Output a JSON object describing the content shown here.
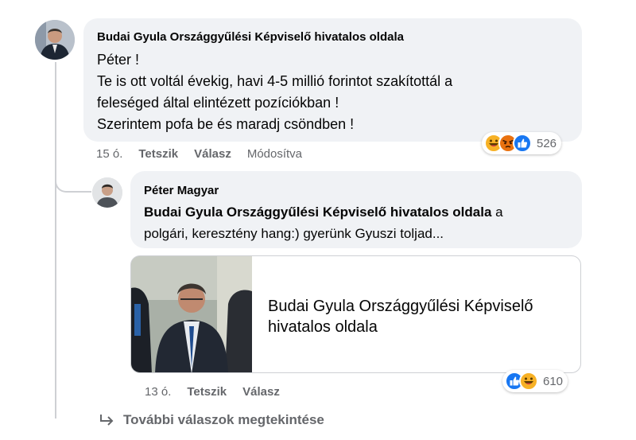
{
  "comment1": {
    "author": "Budai Gyula Országgyűlési Képviselő hivatalos oldala",
    "lines": [
      "Péter !",
      "Te is ott voltál évekig, havi 4-5 millió forintot szakítottál a",
      "feleséged által elintézett pozíciókban !",
      "Szerintem pofa be és maradj csöndben !"
    ],
    "time": "15 ó.",
    "like": "Tetszik",
    "reply": "Válasz",
    "edited": "Módosítva",
    "reaction_count": "526",
    "reactions": [
      "haha-icon",
      "angry-icon",
      "like-icon"
    ]
  },
  "comment2": {
    "author": "Péter Magyar",
    "mention": "Budai Gyula Országgyűlési Képviselő hivatalos oldala",
    "text_after_mention": " a",
    "line2": "polgári, keresztény hang:) gyerünk Gyuszi toljad...",
    "time": "13 ó.",
    "like": "Tetszik",
    "reply": "Válasz",
    "reaction_count": "610",
    "reactions": [
      "like-icon",
      "haha-icon"
    ]
  },
  "link_card": {
    "title_line1": "Budai Gyula Országgyűlési Képviselő",
    "title_line2": "hivatalos oldala"
  },
  "more_replies": "További válaszok megtekintése",
  "colors": {
    "bubble": "#f0f2f5",
    "secondary_text": "#65676b",
    "like_blue": "#1877f2",
    "angry_orange": "#e9710f",
    "haha_yellow": "#f7b125"
  }
}
